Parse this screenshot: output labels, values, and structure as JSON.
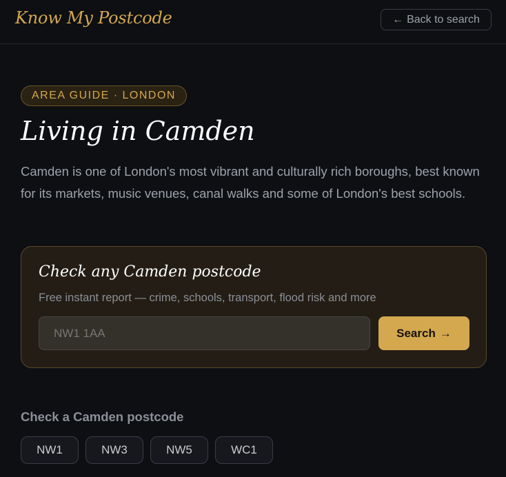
{
  "header": {
    "logo": "Know My Postcode",
    "back_arrow": "←",
    "back_label": "Back to search"
  },
  "hero": {
    "badge": "AREA GUIDE · LONDON",
    "title": "Living in Camden",
    "intro": "Camden is one of London's most vibrant and culturally rich boroughs, best known for its markets, music venues, canal walks and some of London's best schools."
  },
  "search_card": {
    "title": "Check any Camden postcode",
    "subtitle": "Free instant report — crime, schools, transport, flood risk and more",
    "input_placeholder": "NW1 1AA",
    "button_label": "Search",
    "button_arrow": "→"
  },
  "postcodes": {
    "heading": "Check a Camden postcode",
    "items": [
      "NW1",
      "NW3",
      "NW5",
      "WC1"
    ]
  },
  "colors": {
    "accent": "#d4a84f",
    "background": "#0d0f13",
    "card": "#231d15"
  }
}
